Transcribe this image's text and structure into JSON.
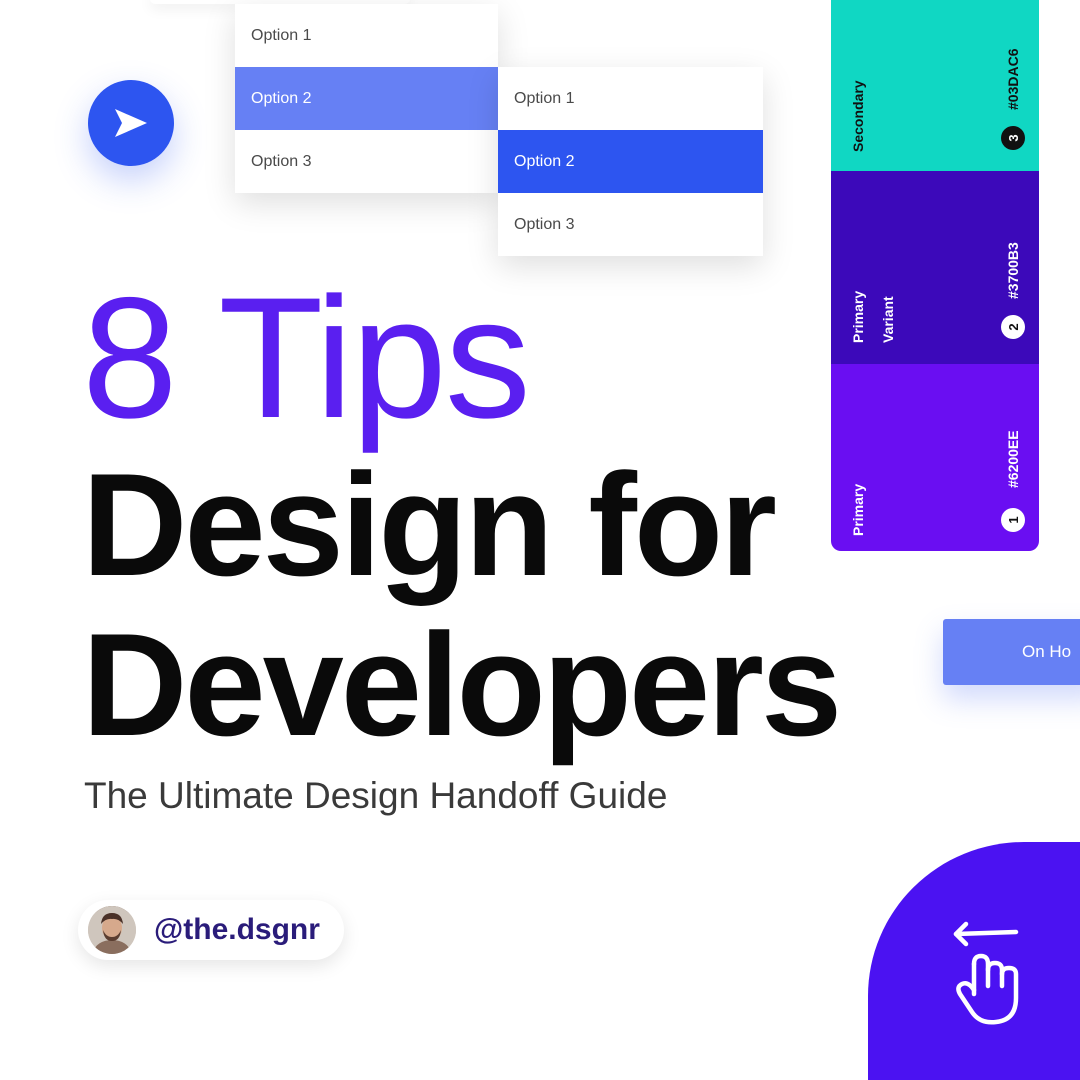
{
  "dropdown_left": {
    "items": [
      "Option 1",
      "Option 2",
      "Option 3"
    ],
    "selected": "Option 2"
  },
  "dropdown_right": {
    "items": [
      "Option 1",
      "Option 2",
      "Option 3"
    ],
    "selected": "Option 2"
  },
  "send_button": {
    "icon": "send-icon",
    "color": "#2d55f0"
  },
  "palette": {
    "swatches": [
      {
        "number": "3",
        "name": "Secondary",
        "hex": "#03DAC6",
        "color": "#10d7c3"
      },
      {
        "number": "2",
        "name_line1": "Primary",
        "name_line2": "Variant",
        "hex": "#3700B3",
        "color": "#3c09ba"
      },
      {
        "number": "1",
        "name": "Primary",
        "hex": "#6200EE",
        "color": "#6a0ef2"
      }
    ]
  },
  "cta_button": {
    "label": "On Ho"
  },
  "headline": {
    "accent": "8 Tips",
    "line1": "Design for",
    "line2": "Developers",
    "subtitle": "The Ultimate Design Handoff Guide",
    "accent_color": "#5a1ff0"
  },
  "author": {
    "handle": "@the.dsgnr"
  },
  "swipe_badge": {
    "icon": "swipe-hand-icon",
    "color": "#4b12f2"
  }
}
